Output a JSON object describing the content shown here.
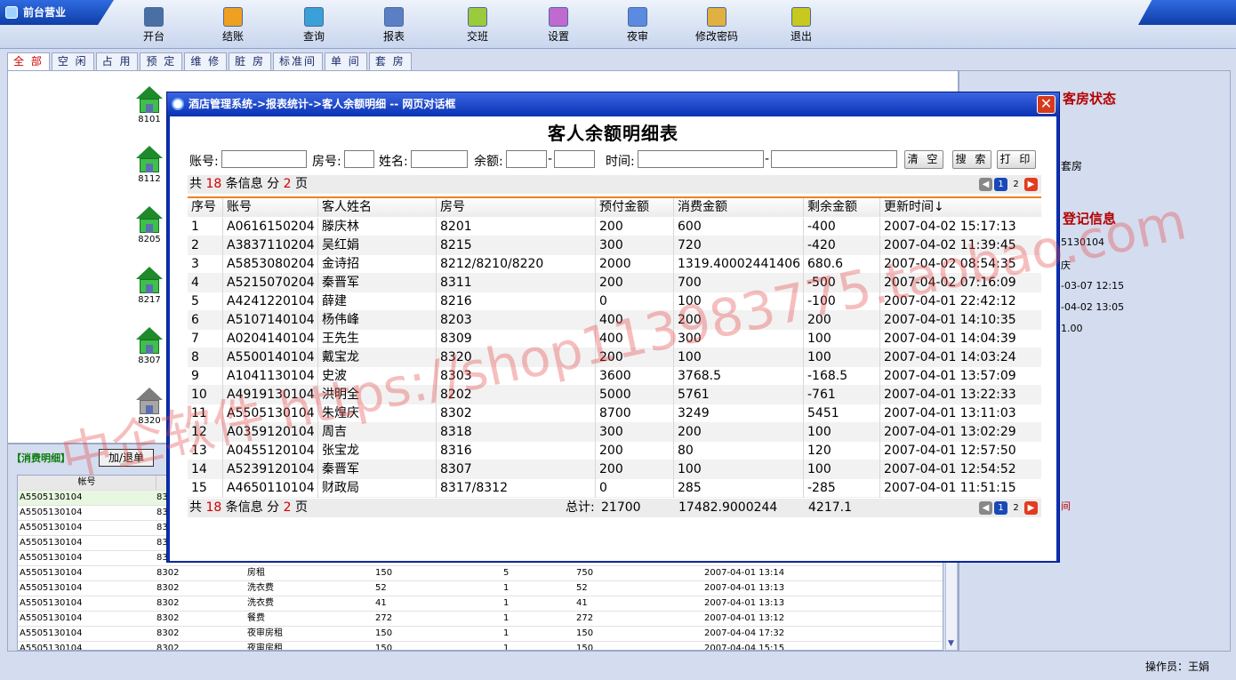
{
  "topbar": {
    "brand": "前台营业",
    "buttons": [
      {
        "label": "开台",
        "icon": "open-table-icon",
        "color": "#4a6fa5"
      },
      {
        "label": "结账",
        "icon": "checkout-icon",
        "color": "#f0a020"
      },
      {
        "label": "查询",
        "icon": "query-icon",
        "color": "#3aa0d8"
      },
      {
        "label": "报表",
        "icon": "report-icon",
        "color": "#5b7fc5"
      },
      {
        "label": "交班",
        "icon": "shift-change-icon",
        "color": "#9acb3c"
      },
      {
        "label": "设置",
        "icon": "settings-icon",
        "color": "#c06ad0"
      },
      {
        "label": "夜审",
        "icon": "night-audit-icon",
        "color": "#5a8be0"
      },
      {
        "label": "修改密码",
        "icon": "change-password-icon",
        "color": "#e0b040"
      },
      {
        "label": "退出",
        "icon": "exit-icon",
        "color": "#c8c820"
      }
    ]
  },
  "tabs": [
    "全 部",
    "空 闲",
    "占 用",
    "预 定",
    "维 修",
    "脏 房",
    "标准间",
    "单 间",
    "套 房"
  ],
  "rooms": [
    {
      "no": "8101",
      "state": "green"
    },
    {
      "no": "8112",
      "state": "green"
    },
    {
      "no": "8205",
      "state": "green"
    },
    {
      "no": "8217",
      "state": "green"
    },
    {
      "no": "8307",
      "state": "green"
    },
    {
      "no": "8320",
      "state": "grey"
    }
  ],
  "right_panel": {
    "room_status_title": "客房状态",
    "room_type_fragment": "套房",
    "reg_title": "登记信息",
    "reg_lines": [
      "5130104",
      "庆",
      "-03-07 12:15",
      "-04-02 13:05",
      "1.00"
    ],
    "footer_fragment": "间"
  },
  "consume": {
    "title": "【消费明细】",
    "add_button": "加/退单",
    "header_account": "帐号",
    "rows": [
      {
        "acct": "A5505130104",
        "room": "83"
      },
      {
        "acct": "A5505130104",
        "room": "83"
      },
      {
        "acct": "A5505130104",
        "room": "83"
      },
      {
        "acct": "A5505130104",
        "room": "83"
      },
      {
        "acct": "A5505130104",
        "room": "83"
      },
      {
        "acct": "A5505130104",
        "room": "8302",
        "item": "房租",
        "price": "150",
        "qty": "5",
        "amount": "750",
        "time": "2007-04-01  13:14"
      },
      {
        "acct": "A5505130104",
        "room": "8302",
        "item": "洗衣费",
        "price": "52",
        "qty": "1",
        "amount": "52",
        "time": "2007-04-01  13:13"
      },
      {
        "acct": "A5505130104",
        "room": "8302",
        "item": "洗衣费",
        "price": "41",
        "qty": "1",
        "amount": "41",
        "time": "2007-04-01  13:13"
      },
      {
        "acct": "A5505130104",
        "room": "8302",
        "item": "餐费",
        "price": "272",
        "qty": "1",
        "amount": "272",
        "time": "2007-04-01  13:12"
      },
      {
        "acct": "A5505130104",
        "room": "8302",
        "item": "夜审房租",
        "price": "150",
        "qty": "1",
        "amount": "150",
        "time": "2007-04-04  17:32"
      },
      {
        "acct": "A5505130104",
        "room": "8302",
        "item": "夜审房租",
        "price": "150",
        "qty": "1",
        "amount": "150",
        "time": "2007-04-04  15:15"
      }
    ]
  },
  "status": {
    "operator": "操作员：王娟"
  },
  "dialog": {
    "title": "酒店管理系统->报表统计->客人余额明细  --  网页对话框",
    "close": "✕",
    "report_title": "客人余额明细表",
    "filters": {
      "account": "账号:",
      "room": "房号:",
      "name": "姓名:",
      "balance": "余额:",
      "dash": "-",
      "time": "时间:",
      "clear": "清 空",
      "search": "搜 索",
      "print": "打 印"
    },
    "info": {
      "prefix": "共",
      "count": "18",
      "mid": "条信息  分",
      "pages": "2",
      "suffix": "页"
    },
    "pager": {
      "prev": "◀",
      "p1": "1",
      "p2": "2",
      "next": "▶"
    },
    "columns": [
      "序号",
      "账号",
      "客人姓名",
      "房号",
      "预付金额",
      "消费金额",
      "剩余金额",
      "更新时间↓"
    ],
    "rows": [
      [
        "1",
        "A0616150204",
        "滕庆林",
        "8201",
        "200",
        "600",
        "-400",
        "2007-04-02 15:17:13"
      ],
      [
        "2",
        "A3837110204",
        "吴红娟",
        "8215",
        "300",
        "720",
        "-420",
        "2007-04-02 11:39:45"
      ],
      [
        "3",
        "A5853080204",
        "金诗招",
        "8212/8210/8220",
        "2000",
        "1319.40002441406",
        "680.6",
        "2007-04-02 08:54:35"
      ],
      [
        "4",
        "A5215070204",
        "秦晋军",
        "8311",
        "200",
        "700",
        "-500",
        "2007-04-02 07:16:09"
      ],
      [
        "5",
        "A4241220104",
        "薛建",
        "8216",
        "0",
        "100",
        "-100",
        "2007-04-01 22:42:12"
      ],
      [
        "6",
        "A5107140104",
        "杨伟峰",
        "8203",
        "400",
        "200",
        "200",
        "2007-04-01 14:10:35"
      ],
      [
        "7",
        "A0204140104",
        "王先生",
        "8309",
        "400",
        "300",
        "100",
        "2007-04-01 14:04:39"
      ],
      [
        "8",
        "A5500140104",
        "戴宝龙",
        "8320",
        "200",
        "100",
        "100",
        "2007-04-01 14:03:24"
      ],
      [
        "9",
        "A1041130104",
        "史波",
        "8303",
        "3600",
        "3768.5",
        "-168.5",
        "2007-04-01 13:57:09"
      ],
      [
        "10",
        "A4919130104",
        "洪明全",
        "8202",
        "5000",
        "5761",
        "-761",
        "2007-04-01 13:22:33"
      ],
      [
        "11",
        "A5505130104",
        "朱煌庆",
        "8302",
        "8700",
        "3249",
        "5451",
        "2007-04-01 13:11:03"
      ],
      [
        "12",
        "A0359120104",
        "周吉",
        "8318",
        "300",
        "200",
        "100",
        "2007-04-01 13:02:29"
      ],
      [
        "13",
        "A0455120104",
        "张宝龙",
        "8316",
        "200",
        "80",
        "120",
        "2007-04-01 12:57:50"
      ],
      [
        "14",
        "A5239120104",
        "秦晋军",
        "8307",
        "200",
        "100",
        "100",
        "2007-04-01 12:54:52"
      ],
      [
        "15",
        "A4650110104",
        "财政局",
        "8317/8312",
        "0",
        "285",
        "-285",
        "2007-04-01 11:51:15"
      ]
    ],
    "totals": {
      "label": "总计:",
      "prepaid": "21700",
      "consumed": "17482.9000244",
      "remain": "4217.1"
    }
  },
  "watermark": "中企软件 https://shop113983775.taobao.com"
}
